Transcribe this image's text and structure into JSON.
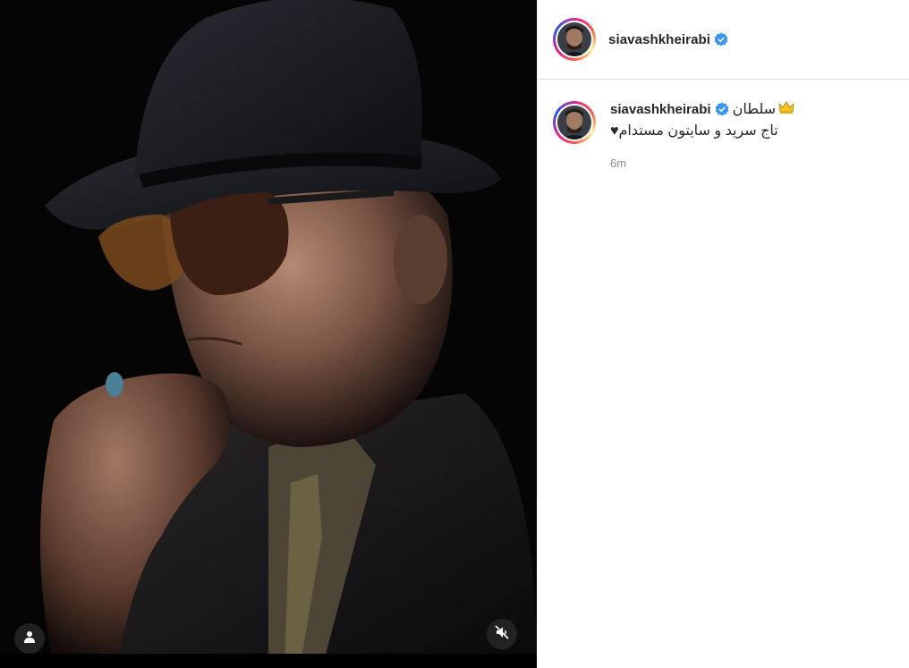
{
  "post": {
    "username": "siavashkheirabi",
    "verified": true,
    "caption_line1": "سلطان",
    "caption_line2": "تاج سر‌ید و سایتون مستدام",
    "heart": "♥",
    "timestamp": "6m"
  },
  "media": {
    "tag_icon": "user-tag-icon",
    "mute_icon": "muted-speaker-icon"
  },
  "colors": {
    "verified": "#3897f0",
    "muted_text": "#8e8e8e",
    "border": "#dbdbdb"
  }
}
